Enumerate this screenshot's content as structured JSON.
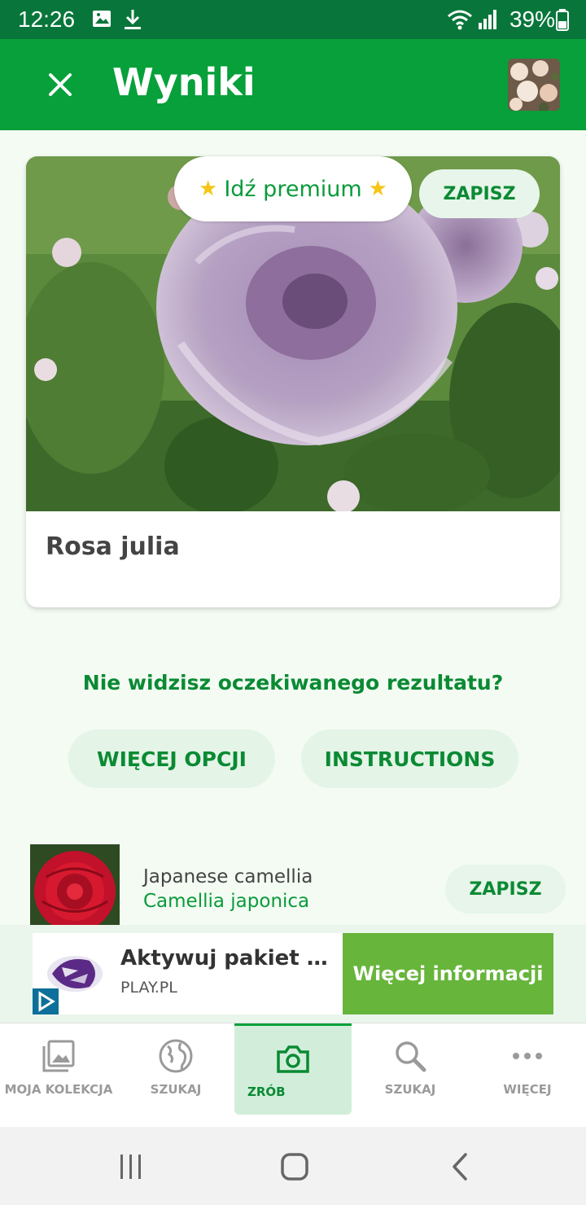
{
  "status_bar": {
    "time": "12:26",
    "battery": "39%"
  },
  "app_bar": {
    "title": "Wyniki"
  },
  "premium_label": "Idź premium",
  "top_save_label": "ZAPISZ",
  "result": {
    "name": "Rosa julia"
  },
  "prompt_question": "Nie widzisz oczekiwanego rezultatu?",
  "buttons": {
    "more_options": "WIĘCEJ OPCJI",
    "instructions": "INSTRUCTIONS"
  },
  "second_result": {
    "common_name": "Japanese camellia",
    "latin_name": "Camellia japonica",
    "save_label": "ZAPISZ"
  },
  "ad": {
    "headline": "Aktywuj pakiet w P...",
    "domain": "PLAY.PL",
    "cta": "Więcej informacji"
  },
  "bottom_nav": {
    "items": [
      {
        "label": "MOJA KOLEKCJA",
        "icon": "gallery-icon"
      },
      {
        "label": "SZUKAJ",
        "icon": "globe-icon"
      },
      {
        "label": "ZRÓB",
        "icon": "camera-icon"
      },
      {
        "label": "SZUKAJ",
        "icon": "search-icon"
      },
      {
        "label": "WIĘCEJ",
        "icon": "more-icon"
      }
    ],
    "active_index": 2
  },
  "colors": {
    "status_bar": "#08763a",
    "app_bar": "#07a03a",
    "accent_green": "#0a8a33",
    "cta_green": "#67b53b"
  }
}
